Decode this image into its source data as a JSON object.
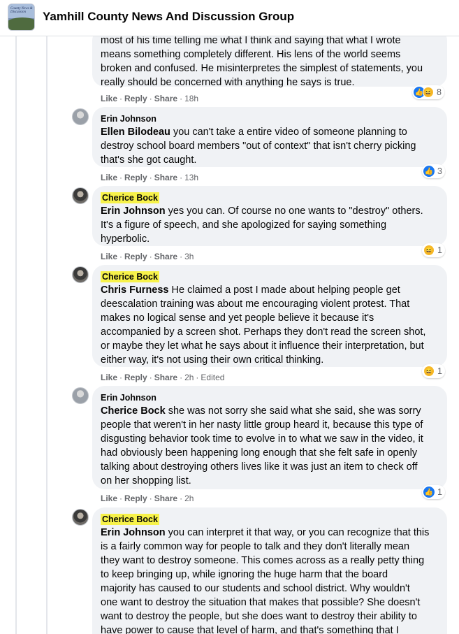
{
  "header": {
    "group_name": "Yamhill County News And Discussion Group",
    "thumb_text": "County News & Discussion"
  },
  "actions": {
    "like": "Like",
    "reply": "Reply",
    "share": "Share",
    "sep": "·"
  },
  "comments": [
    {
      "author": "",
      "highlight": false,
      "mention": "",
      "lines": [
        "most of his time telling me what I think and saying that what I wrote",
        "means something completely different. His lens of the world seems",
        "broken and confused. He misinterpretes the simplest of statements, you",
        "really should be concerned with anything he says is true."
      ],
      "time": "18h",
      "edited": "",
      "reactions": [
        "like",
        "haha"
      ],
      "reaction_count": "8"
    },
    {
      "author": "Erin Johnson",
      "highlight": false,
      "mention": "Ellen Bilodeau",
      "lines": [
        " you can't take a entire video of someone planning to",
        "destroy school board members \"out of context\" that isn't cherry picking",
        "that's she got caught."
      ],
      "time": "13h",
      "edited": "",
      "reactions": [
        "like"
      ],
      "reaction_count": "3"
    },
    {
      "author": "Cherice Bock",
      "highlight": true,
      "mention": "Erin Johnson",
      "lines": [
        " yes you can. Of course no one wants to \"destroy\" others.",
        "It's a figure of speech, and she apologized for saying something",
        "hyperbolic."
      ],
      "time": "3h",
      "edited": "",
      "reactions": [
        "haha"
      ],
      "reaction_count": "1"
    },
    {
      "author": "Cherice Bock",
      "highlight": true,
      "mention": "Chris Furness",
      "lines": [
        " He claimed a post I made about helping people get",
        "deescalation training was about me encouraging violent protest. That",
        "makes no logical sense and yet people believe it because it's",
        "accompanied by a screen shot. Perhaps they don't read the screen shot,",
        "or maybe they let what he says about it influence their interpretation, but",
        "either way, it's not using their own critical thinking."
      ],
      "time": "2h",
      "edited": "Edited",
      "reactions": [
        "haha"
      ],
      "reaction_count": "1"
    },
    {
      "author": "Erin Johnson",
      "highlight": false,
      "mention": "Cherice Bock",
      "lines": [
        " she was not sorry she said what she said, she was sorry",
        "people that weren't in her nasty little group heard it, because this type of",
        "disgusting behavior took time to evolve in to what we saw in the video, it",
        "had obviously been happening long enough that she felt safe in openly",
        "talking about destroying others lives like it was just an item to check off",
        "on her shopping list."
      ],
      "time": "2h",
      "edited": "",
      "reactions": [
        "like"
      ],
      "reaction_count": "1"
    },
    {
      "author": "Cherice Bock",
      "highlight": true,
      "mention": "Erin Johnson",
      "lines": [
        " you can interpret it that way, or you can recognize that this",
        "is a fairly common way for people to talk and they don't literally mean",
        "they want to destroy someone. This comes across as a really petty thing",
        "to keep bringing up, while ignoring the huge harm that the board",
        "majority has caused to our students and school district. Why wouldn't",
        "one want to destroy the situation that makes that possible? She doesn't",
        "want to destroy the people, but she does want to destroy their ability to",
        "have power to cause that level of harm, and that's something that I"
      ],
      "time": "",
      "edited": "",
      "reactions": [],
      "reaction_count": ""
    }
  ]
}
